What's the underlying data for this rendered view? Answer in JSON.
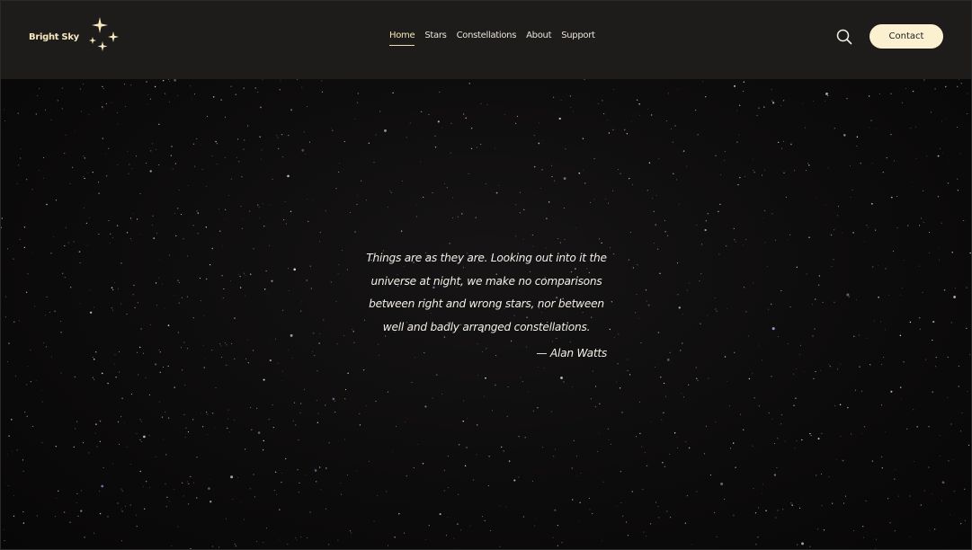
{
  "brand": {
    "name": "Bright Sky",
    "logo_icon": "sparkle-stars-icon"
  },
  "nav": {
    "items": [
      {
        "label": "Home",
        "active": true
      },
      {
        "label": "Stars",
        "active": false
      },
      {
        "label": "Constellations",
        "active": false
      },
      {
        "label": "About",
        "active": false
      },
      {
        "label": "Support",
        "active": false
      }
    ]
  },
  "header": {
    "search_icon": "search-icon",
    "contact_label": "Contact"
  },
  "hero": {
    "quote_lines": [
      "Things are as they are. Looking out into it the",
      "universe at night, we make no comparisons",
      "between right and wrong stars, nor between",
      "well and badly arranged constellations."
    ],
    "attribution": "— Alan Watts"
  },
  "colors": {
    "header_bg": "#1d1c1b",
    "accent": "#f7e8bf",
    "button_bg": "#fbf0cf",
    "hero_bg": "#0c0b0b"
  }
}
